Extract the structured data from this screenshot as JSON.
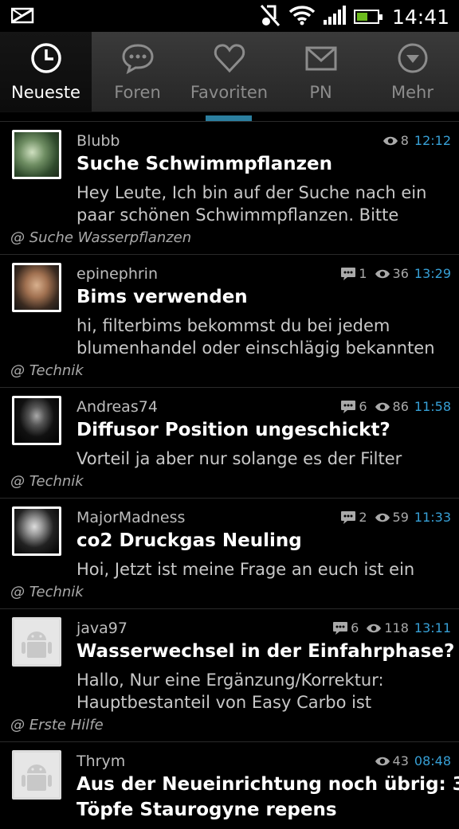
{
  "status_bar": {
    "time": "14:41",
    "icons": [
      "mail-icon",
      "mute-icon",
      "wifi-icon",
      "signal-icon",
      "battery-icon"
    ],
    "battery_level": 0.55,
    "battery_color": "#6dbb1e"
  },
  "tabs": [
    {
      "label": "Neueste",
      "icon": "clock-icon",
      "active": true
    },
    {
      "label": "Foren",
      "icon": "chat-bubble-icon",
      "active": false
    },
    {
      "label": "Favoriten",
      "icon": "heart-icon",
      "active": false
    },
    {
      "label": "PN",
      "icon": "envelope-icon",
      "active": false
    },
    {
      "label": "Mehr",
      "icon": "more-icon",
      "active": false
    }
  ],
  "colors": {
    "accent": "#37a0d6",
    "indicator": "#2c7f9f"
  },
  "threads": [
    {
      "user": "Blubb",
      "title": "Suche Schwimmpflanzen",
      "preview": [
        "Hey Leute, Ich bin auf der Suche nach ein",
        "paar schönen Schwimmpflanzen.  Bitte"
      ],
      "forum": "@ Suche Wasserpflanzen",
      "replies": "",
      "views": "8",
      "time": "12:12",
      "avatar": "plant-photo"
    },
    {
      "user": "epinephrin",
      "title": "Bims verwenden",
      "preview": [
        "hi, filterbims bekommst du bei jedem",
        "blumenhandel oder einschlägig bekannten"
      ],
      "forum": "@ Technik",
      "replies": "1",
      "views": "36",
      "time": "13:29",
      "avatar": "face-photo"
    },
    {
      "user": "Andreas74",
      "title": "Diffusor Position ungeschickt?",
      "preview": [
        "Vorteil ja aber nur solange es der Filter"
      ],
      "forum": "@ Technik",
      "replies": "6",
      "views": "86",
      "time": "11:58",
      "avatar": "dark-face-photo"
    },
    {
      "user": "MajorMadness",
      "title": "co2 Druckgas Neuling",
      "preview": [
        "Hoi,   Jetzt ist meine Frage an euch ist ein"
      ],
      "forum": "@ Technik",
      "replies": "2",
      "views": "59",
      "time": "11:33",
      "avatar": "portrait-photo"
    },
    {
      "user": "java97",
      "title": "Wasserwechsel in der Einfahrphase?",
      "preview": [
        "Hallo, Nur eine Ergänzung/Korrektur:",
        "Hauptbestanteil von Easy Carbo ist"
      ],
      "forum": "@ Erste Hilfe",
      "replies": "6",
      "views": "118",
      "time": "13:11",
      "avatar": "android-placeholder"
    },
    {
      "user": "Thrym",
      "title": "Aus der Neueinrichtung noch übrig: 3",
      "title2": "Töpfe Staurogyne repens",
      "preview": [],
      "forum": "",
      "replies": "",
      "views": "43",
      "time": "08:48",
      "avatar": "android-placeholder"
    }
  ]
}
